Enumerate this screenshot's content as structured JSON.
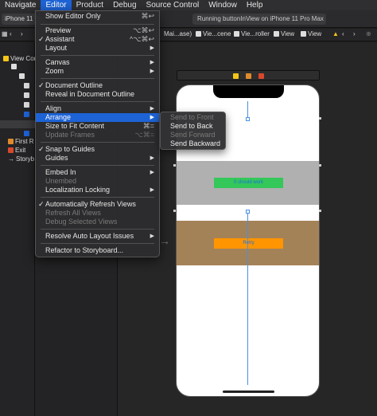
{
  "menubar": {
    "items": [
      "Navigate",
      "Editor",
      "Product",
      "Debug",
      "Source Control",
      "Window",
      "Help"
    ]
  },
  "toolbar": {
    "scheme": "iPhone 11 Pr",
    "status": "Running buttonInView on iPhone 11 Pro Max"
  },
  "jumpbar": {
    "items": [
      "Mai...ase)",
      "Vie...cene",
      "Vie...roller",
      "View",
      "View"
    ]
  },
  "navigator": {
    "rows": [
      "View Cor",
      "First R",
      "Exit",
      "Storyb"
    ]
  },
  "scene": {
    "gray_button": "It should work",
    "orange_button": "Retry"
  },
  "editor_menu": {
    "items": [
      {
        "label": "Show Editor Only",
        "shortcut": "⌘↩",
        "check": false,
        "disabled": false,
        "submenu": false
      },
      {
        "label": "Preview",
        "shortcut": "⌥⌘↩",
        "check": false,
        "disabled": false,
        "submenu": false
      },
      {
        "label": "Assistant",
        "shortcut": "^⌥⌘↩",
        "check": true,
        "disabled": false,
        "submenu": false
      },
      {
        "label": "Layout",
        "shortcut": "",
        "check": false,
        "disabled": false,
        "submenu": true
      },
      {
        "label": "Canvas",
        "shortcut": "",
        "check": false,
        "disabled": false,
        "submenu": true
      },
      {
        "label": "Zoom",
        "shortcut": "",
        "check": false,
        "disabled": false,
        "submenu": true
      },
      {
        "label": "Document Outline",
        "shortcut": "",
        "check": true,
        "disabled": false,
        "submenu": false
      },
      {
        "label": "Reveal in Document Outline",
        "shortcut": "",
        "check": false,
        "disabled": false,
        "submenu": false
      },
      {
        "label": "Align",
        "shortcut": "",
        "check": false,
        "disabled": false,
        "submenu": true
      },
      {
        "label": "Arrange",
        "shortcut": "",
        "check": false,
        "disabled": false,
        "submenu": true
      },
      {
        "label": "Size to Fit Content",
        "shortcut": "⌘=",
        "check": false,
        "disabled": false,
        "submenu": false
      },
      {
        "label": "Update Frames",
        "shortcut": "⌥⌘=",
        "check": false,
        "disabled": true,
        "submenu": false
      },
      {
        "label": "Snap to Guides",
        "shortcut": "",
        "check": true,
        "disabled": false,
        "submenu": false
      },
      {
        "label": "Guides",
        "shortcut": "",
        "check": false,
        "disabled": false,
        "submenu": true
      },
      {
        "label": "Embed In",
        "shortcut": "",
        "check": false,
        "disabled": false,
        "submenu": true
      },
      {
        "label": "Unembed",
        "shortcut": "",
        "check": false,
        "disabled": true,
        "submenu": false
      },
      {
        "label": "Localization Locking",
        "shortcut": "",
        "check": false,
        "disabled": false,
        "submenu": true
      },
      {
        "label": "Automatically Refresh Views",
        "shortcut": "",
        "check": true,
        "disabled": false,
        "submenu": false
      },
      {
        "label": "Refresh All Views",
        "shortcut": "",
        "check": false,
        "disabled": true,
        "submenu": false
      },
      {
        "label": "Debug Selected Views",
        "shortcut": "",
        "check": false,
        "disabled": true,
        "submenu": false
      },
      {
        "label": "Resolve Auto Layout Issues",
        "shortcut": "",
        "check": false,
        "disabled": false,
        "submenu": true
      },
      {
        "label": "Refactor to Storyboard...",
        "shortcut": "",
        "check": false,
        "disabled": false,
        "submenu": false
      }
    ]
  },
  "arrange_submenu": {
    "items": [
      {
        "label": "Send to Front",
        "disabled": true
      },
      {
        "label": "Send to Back",
        "disabled": false
      },
      {
        "label": "Send Forward",
        "disabled": true
      },
      {
        "label": "Send Backward",
        "disabled": false
      }
    ]
  },
  "glyphs": {
    "check": "✓",
    "arrow": "▶"
  }
}
